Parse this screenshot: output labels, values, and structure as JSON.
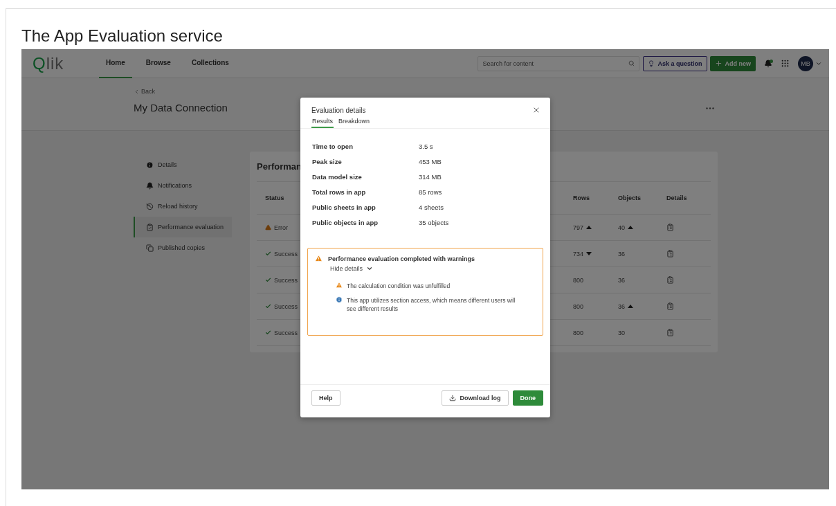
{
  "page_title": "The App Evaluation service",
  "header": {
    "logo": "Qlik",
    "nav": [
      {
        "label": "Home",
        "selected": true
      },
      {
        "label": "Browse",
        "selected": false
      },
      {
        "label": "Collections",
        "selected": false
      }
    ],
    "search": {
      "placeholder": "Search for content"
    },
    "ask_button": "Ask a question",
    "add_button": "Add new",
    "has_unread": true,
    "avatar": "MB"
  },
  "subheader": {
    "back": "Back",
    "title": "My Data Connection"
  },
  "sidebar": [
    {
      "label": "Details",
      "kind": "info",
      "selected": false
    },
    {
      "label": "Notifications",
      "kind": "bell",
      "selected": false
    },
    {
      "label": "Reload history",
      "kind": "history",
      "selected": false
    },
    {
      "label": "Performance evaluation",
      "kind": "clipboard",
      "selected": true
    },
    {
      "label": "Published copies",
      "kind": "copies",
      "selected": false
    }
  ],
  "card": {
    "title": "Performan",
    "columns": [
      "Status",
      "Rows",
      "Objects",
      "Details"
    ],
    "rows": [
      {
        "kind": "error",
        "status": "Error",
        "rows": {
          "value": "797",
          "kind": "up"
        },
        "objects": {
          "value": "40",
          "kind": "up"
        }
      },
      {
        "kind": "success",
        "status": "Success",
        "rows": {
          "value": "734",
          "kind": "down"
        },
        "objects": {
          "value": "36",
          "kind": "none"
        }
      },
      {
        "kind": "success",
        "status": "Success",
        "rows": {
          "value": "800",
          "kind": "none"
        },
        "objects": {
          "value": "36",
          "kind": "none"
        }
      },
      {
        "kind": "success",
        "status": "Success",
        "rows": {
          "value": "800",
          "kind": "none"
        },
        "objects": {
          "value": "36",
          "kind": "up"
        }
      },
      {
        "kind": "success",
        "status": "Success",
        "rows": {
          "value": "800",
          "kind": "none"
        },
        "objects": {
          "value": "30",
          "kind": "none"
        }
      }
    ]
  },
  "modal": {
    "title": "Evaluation details",
    "tabs": [
      {
        "label": "Results",
        "selected": true
      },
      {
        "label": "Breakdown",
        "selected": false
      }
    ],
    "metrics": [
      {
        "label": "Time to open",
        "value": "3.5 s"
      },
      {
        "label": "Peak size",
        "value": "453 MB"
      },
      {
        "label": "Data model size",
        "value": "314 MB"
      },
      {
        "label": "Total rows in app",
        "value": "85 rows"
      },
      {
        "label": "Public sheets in app",
        "value": "4 sheets"
      },
      {
        "label": "Public objects in app",
        "value": "35 objects"
      }
    ],
    "alert": {
      "title": "Performance evaluation completed with warnings",
      "toggle": "Hide details",
      "expanded": true,
      "items": [
        {
          "kind": "warning",
          "text": "The calculation condition was unfulfilled"
        },
        {
          "kind": "info",
          "text": "This app utilizes section access, which means different users will see different results"
        }
      ]
    },
    "help_button": "Help",
    "download_button": "Download log",
    "done_button": "Done"
  }
}
